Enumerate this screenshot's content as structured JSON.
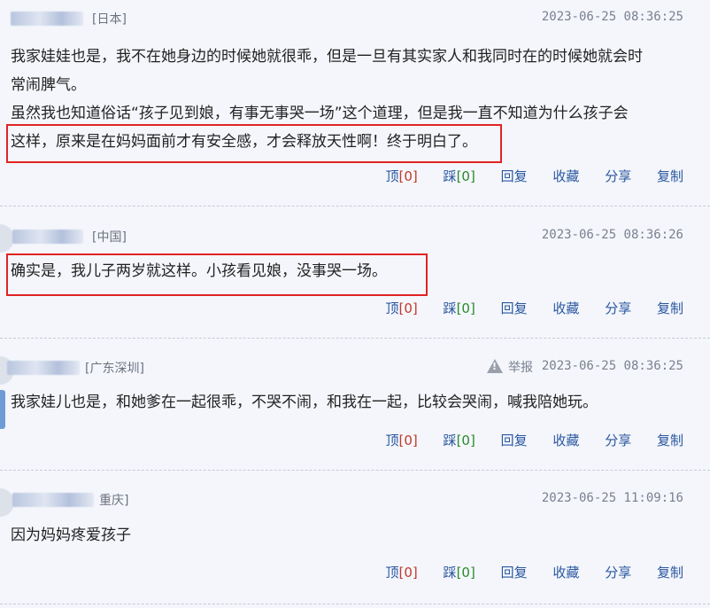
{
  "comments": [
    {
      "location": "[日本]",
      "time": "2023-06-25 08:36:25",
      "lines": [
        "我家娃娃也是，我不在她身边的时候她就很乖，但是一旦有其实家人和我同时在的时候她就会时",
        "常闹脾气。",
        "虽然我也知道俗话“孩子见到娘，有事无事哭一场”这个道理，但是我一直不知道为什么孩子会",
        "这样，原来是在妈妈面前才有安全感，才会释放天性啊！终于明白了。"
      ]
    },
    {
      "location": "[中国]",
      "time": "2023-06-25 08:36:26",
      "lines": [
        "确实是，我儿子两岁就这样。小孩看见娘，没事哭一场。"
      ]
    },
    {
      "location": "[广东深圳]",
      "time": "2023-06-25 08:36:25",
      "report": "举报",
      "lines": [
        "我家娃儿也是，和她爹在一起很乖，不哭不闹，和我在一起，比较会哭闹，喊我陪她玩。"
      ]
    },
    {
      "location": "重庆]",
      "time": "2023-06-25 11:09:16",
      "lines": [
        "因为妈妈疼爱孩子"
      ]
    }
  ],
  "actions": {
    "up": "顶",
    "up_count": "[0]",
    "down": "踩",
    "down_count": "[0]",
    "reply": "回复",
    "favorite": "收藏",
    "share": "分享",
    "copy": "复制"
  }
}
